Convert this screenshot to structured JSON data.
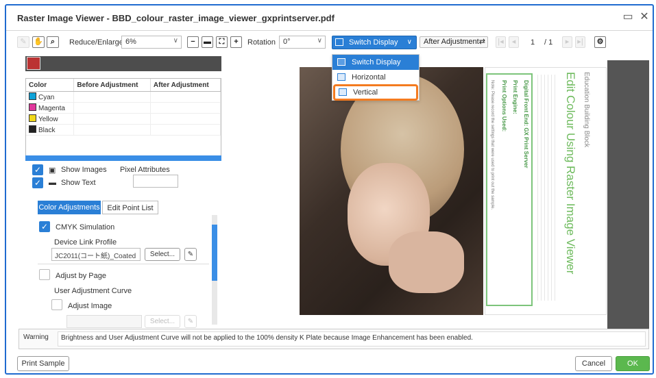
{
  "window": {
    "title": "Raster Image Viewer - BBD_colour_raster_image_viewer_gxprintserver.pdf"
  },
  "toolbar": {
    "reduce_label": "Reduce/Enlarge",
    "zoom_value": "6%",
    "rotation_label": "Rotation",
    "rotation_value": "0°",
    "switch_display_label": "Switch Display",
    "after_adjustment_label": "After Adjustment",
    "page_current": "1",
    "page_total": "/ 1"
  },
  "dropdown": {
    "items": [
      {
        "label": "Switch Display"
      },
      {
        "label": "Horizontal"
      },
      {
        "label": "Vertical"
      }
    ]
  },
  "color_table": {
    "headers": [
      "Color",
      "Before Adjustment",
      "After Adjustment"
    ],
    "rows": [
      {
        "name": "Cyan",
        "color": "#0ea2d8"
      },
      {
        "name": "Magenta",
        "color": "#e0379b"
      },
      {
        "name": "Yellow",
        "color": "#f0d81a"
      },
      {
        "name": "Black",
        "color": "#222222"
      }
    ]
  },
  "options": {
    "show_images": "Show Images",
    "pixel_attributes": "Pixel Attributes",
    "show_text": "Show Text"
  },
  "tabs": {
    "color_adjustments": "Color Adjustments",
    "edit_point_list": "Edit Point List"
  },
  "adjust": {
    "cmyk_simulation": "CMYK Simulation",
    "device_link_profile": "Device Link Profile",
    "profile_value": "JC2011(コート紙)_Coated",
    "select_label": "Select...",
    "adjust_by_page": "Adjust by Page",
    "user_adjustment_curve": "User Adjustment Curve",
    "adjust_image": "Adjust Image",
    "select_disabled_label": "Select..."
  },
  "preview_doc": {
    "heading_small": "Education Building Block",
    "heading_large": "Edit Colour Using Raster Image Viewer",
    "form_line1": "Digital Front End: GX Print Server",
    "form_line2": "Print Engine:",
    "form_line3": "Print Options Used:",
    "note": "Note: Please record the settings that were used to print out the sample."
  },
  "warning": {
    "label": "Warning",
    "text": "Brightness and User Adjustment Curve will not be applied to the 100% density K Plate because Image Enhancement has been enabled."
  },
  "footer": {
    "print_sample": "Print Sample",
    "cancel": "Cancel",
    "ok": "OK"
  }
}
